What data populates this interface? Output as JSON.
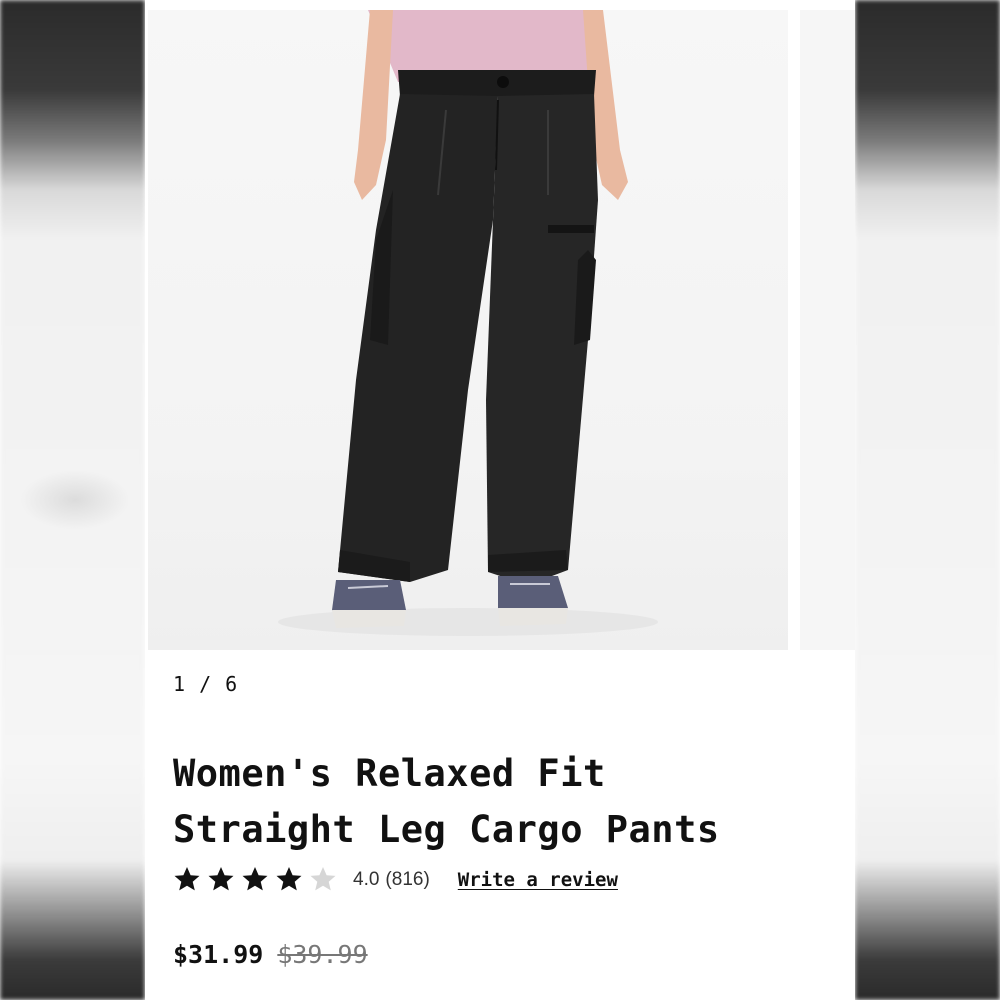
{
  "gallery": {
    "image_alt": "Women's Relaxed Fit Straight Leg Cargo Pants - black",
    "counter": "1 / 6",
    "current": 1,
    "total": 6
  },
  "product": {
    "title_line1": "Women's Relaxed Fit",
    "title_line2": "Straight Leg Cargo Pants",
    "rating": {
      "value": 4.0,
      "value_label": "4.0",
      "count_label": "(816)",
      "max_stars": 5,
      "filled_color": "#111111",
      "empty_color": "#d6d6d6"
    },
    "write_review_label": "Write a review",
    "price_sale": "$31.99",
    "price_original": "$39.99"
  }
}
